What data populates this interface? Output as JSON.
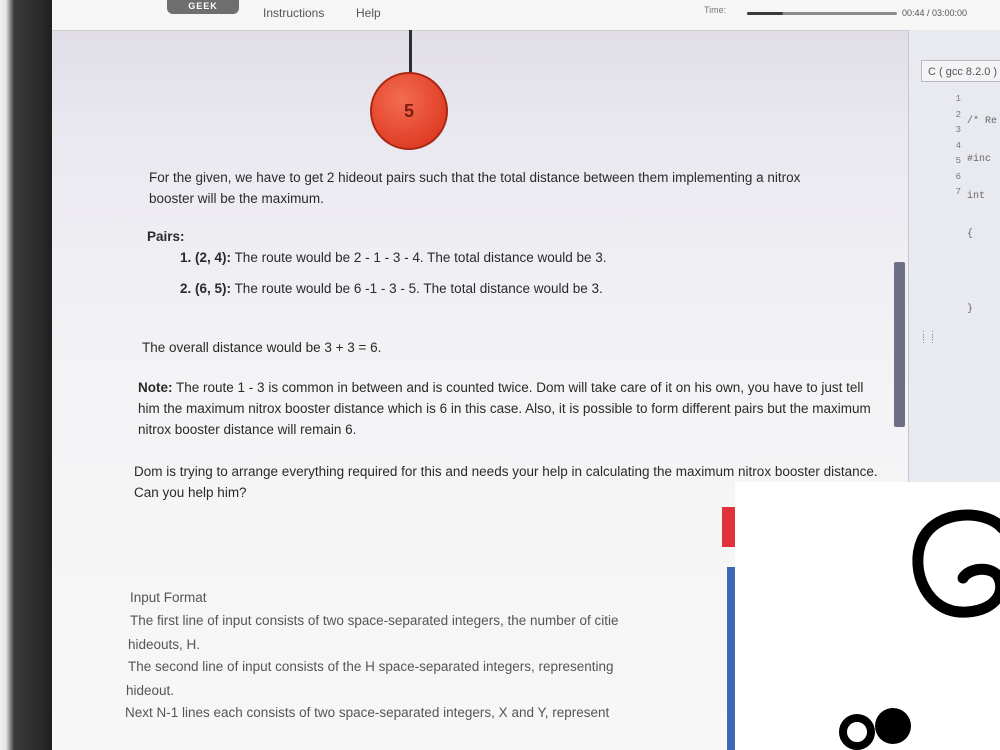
{
  "header": {
    "logo_text": "GEEK",
    "nav": [
      "Instructions",
      "Help"
    ],
    "time_label": "Time:",
    "time_value": "00:44 / 03:00:00",
    "time_progress": 0.24
  },
  "tree_node": {
    "label": "5",
    "color": "#e6452c"
  },
  "problem": {
    "intro": "For the given, we have to get 2 hideout pairs such that the total distance between them implementing a nitrox booster will be the maximum.",
    "pairs_heading": "Pairs:",
    "pairs": [
      {
        "num": "1.",
        "pair": "(2, 4):",
        "text": "The route would be 2 - 1 - 3 - 4. The total distance would be 3."
      },
      {
        "num": "2.",
        "pair": "(6, 5):",
        "text": "The route would be 6 -1 - 3 - 5. The total distance would be 3."
      }
    ],
    "overall": "The overall distance would be 3 + 3 = 6.",
    "note_label": "Note:",
    "note_text": "The route 1 - 3 is common in between and is counted twice. Dom will take care of it on his own, you have to just tell him the maximum nitrox booster distance which is 6 in this case. Also, it is possible to form different pairs but the maximum nitrox booster distance will remain 6.",
    "help_request": "Dom is trying to arrange everything required for this and needs your help in calculating the maximum nitrox booster distance. Can you help him?",
    "input_format_title": "Input Format",
    "input_lines": [
      "The first line of input consists of two space-separated integers, the number of citie",
      "hideouts, H.",
      "The second line of input consists of the H space-separated integers, representing",
      "hideout.",
      "Next N-1 lines each consists of two space-separated integers, X and Y, represent"
    ]
  },
  "editor": {
    "language": "C ( gcc 8.2.0 )",
    "line_numbers": [
      "1",
      "2",
      "3",
      "4",
      "5",
      "6",
      "7"
    ],
    "code_lines": [
      "/* Re",
      "#inc",
      "int",
      "{",
      "",
      "}",
      ""
    ]
  },
  "overlay": {
    "letter": "G"
  },
  "colors": {
    "accent_red": "#e0323a",
    "accent_blue": "#3f68b3",
    "scrollbar": "#6c6f86"
  }
}
